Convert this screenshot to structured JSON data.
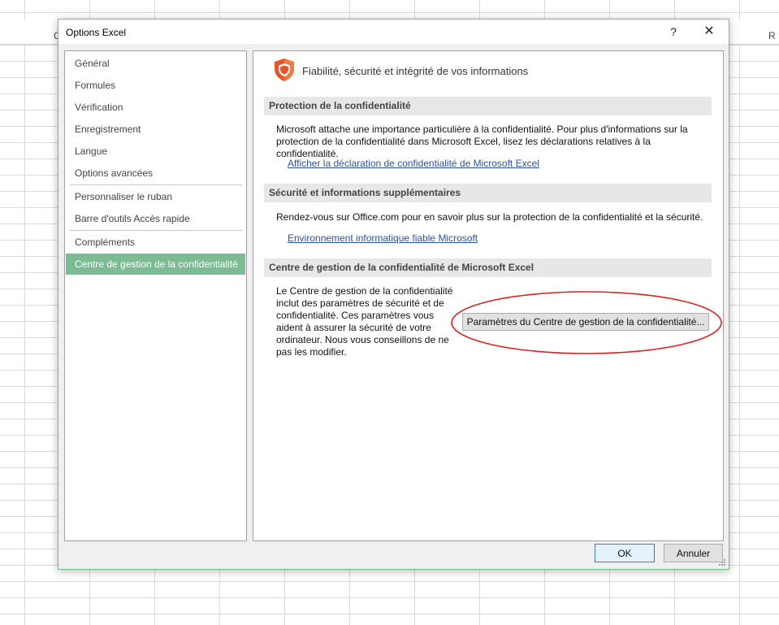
{
  "spreadsheet": {
    "column_letters": [
      "C",
      "R"
    ]
  },
  "dialog": {
    "title": "Options Excel",
    "help_label": "?",
    "close_label": "✕",
    "accent_color": "#7cbb94"
  },
  "nav": {
    "items": [
      {
        "label": "Général"
      },
      {
        "label": "Formules"
      },
      {
        "label": "Vérification"
      },
      {
        "label": "Enregistrement"
      },
      {
        "label": "Langue"
      },
      {
        "label": "Options avancées"
      },
      {
        "label": "Personnaliser le ruban"
      },
      {
        "label": "Barre d'outils Accès rapide"
      },
      {
        "label": "Compléments"
      },
      {
        "label": "Centre de gestion de la confidentialité",
        "selected": true
      }
    ]
  },
  "content": {
    "icon": "shield-icon",
    "title": "Fiabilité, sécurité et intégrité de vos informations",
    "sections": [
      {
        "header": "Protection de la confidentialité",
        "text": "Microsoft attache une importance particulière à la confidentialité. Pour plus d'informations sur la protection de la confidentialité dans Microsoft Excel, lisez les déclarations relatives à la confidentialité.",
        "link": "Afficher la déclaration de confidentialité de Microsoft Excel"
      },
      {
        "header": "Sécurité et informations supplémentaires",
        "text": "Rendez-vous sur Office.com pour en savoir plus sur la protection de la confidentialité et la sécurité.",
        "link": "Environnement informatique fiable Microsoft"
      },
      {
        "header": "Centre de gestion de la confidentialité de Microsoft Excel",
        "text": "Le Centre de gestion de la confidentialité inclut des paramètres de sécurité et de confidentialité. Ces paramètres vous aident à assurer la sécurité de votre ordinateur. Nous vous conseillons de ne pas les modifier.",
        "button": "Paramètres du Centre de gestion de la confidentialité..."
      }
    ],
    "highlight_color": "#e02020"
  },
  "footer": {
    "ok_label": "OK",
    "cancel_label": "Annuler"
  }
}
